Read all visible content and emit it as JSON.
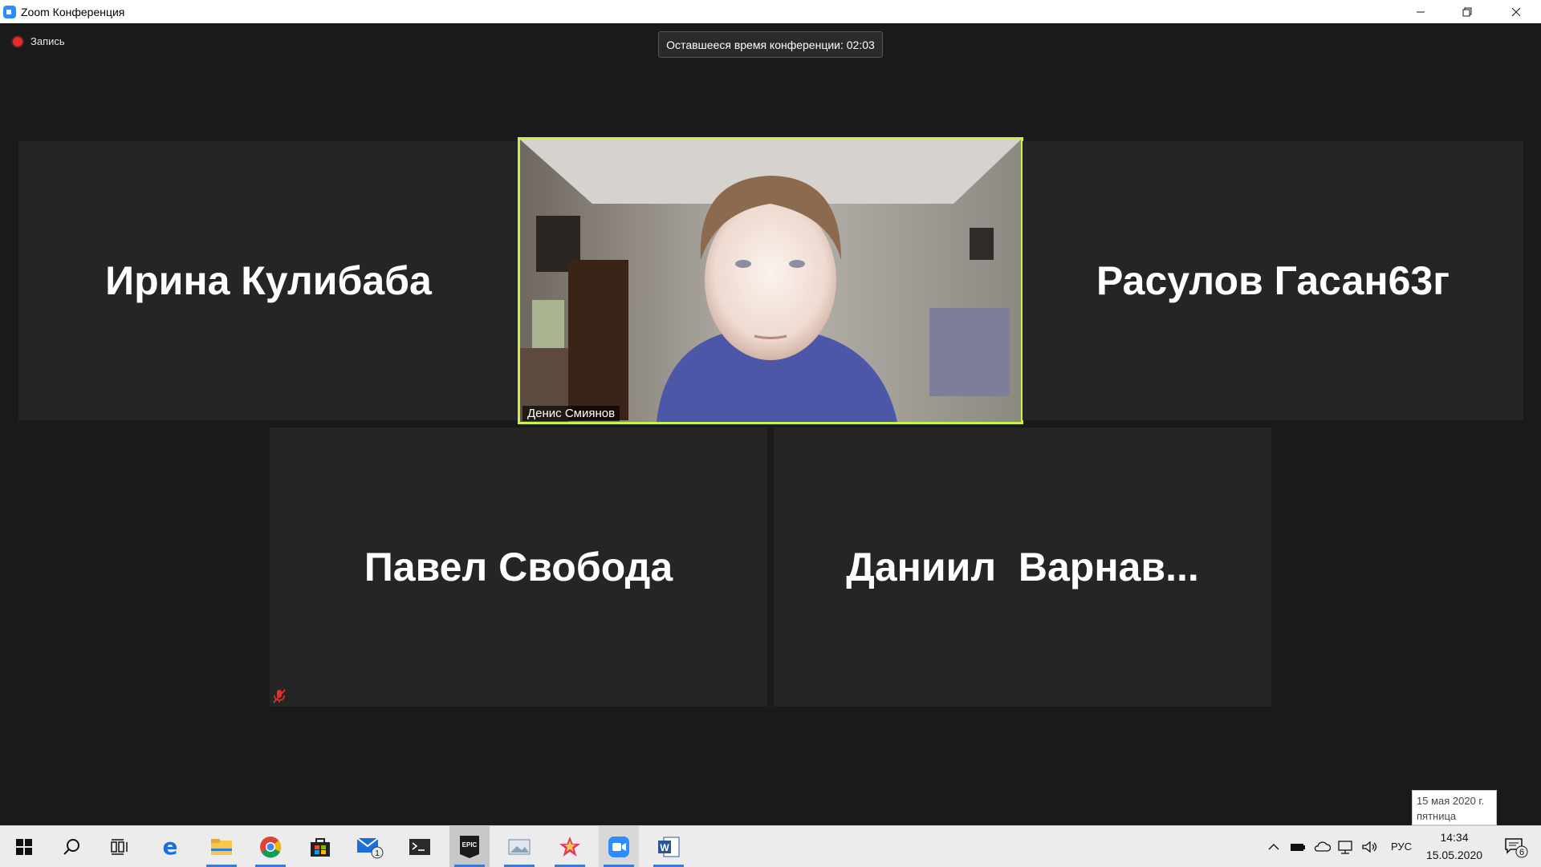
{
  "window": {
    "title": "Zoom Конференция",
    "minimize_icon": "minimize-icon",
    "restore_icon": "restore-icon",
    "close_icon": "close-icon"
  },
  "recording": {
    "label": "Запись"
  },
  "timer": {
    "text": "Оставшееся время конференции: 02:03"
  },
  "participants": [
    {
      "name": "Ирина Кулибаба",
      "video": false,
      "muted": false
    },
    {
      "name": "Денис Смиянов",
      "video": true,
      "active_speaker": true
    },
    {
      "name": "Расулов Гасан63г",
      "video": false,
      "muted": false
    },
    {
      "name": "Павел Свобода",
      "video": false,
      "muted": true
    },
    {
      "name": "Даниил  Варнав...",
      "video": false,
      "muted": false
    }
  ],
  "colors": {
    "active_speaker_border": "#c6f24a",
    "tile_bg": "#252525",
    "stage_bg": "#1a1a1a",
    "taskbar_accent": "#3a7bd5"
  },
  "taskbar": {
    "apps": [
      {
        "name": "start",
        "icon": "windows-start-icon"
      },
      {
        "name": "search",
        "icon": "search-icon"
      },
      {
        "name": "task-view",
        "icon": "task-view-icon"
      },
      {
        "name": "edge",
        "icon": "edge-icon"
      },
      {
        "name": "explorer",
        "icon": "file-explorer-icon",
        "active": true
      },
      {
        "name": "chrome",
        "icon": "chrome-icon",
        "active": true
      },
      {
        "name": "store",
        "icon": "store-icon"
      },
      {
        "name": "mail",
        "icon": "mail-icon",
        "badge": "1"
      },
      {
        "name": "terminal",
        "icon": "terminal-icon"
      },
      {
        "name": "epic",
        "icon": "epic-games-icon",
        "label": "EPIC",
        "active": true
      },
      {
        "name": "photos",
        "icon": "photos-icon",
        "active": true
      },
      {
        "name": "star",
        "icon": "star-app-icon",
        "active": true
      },
      {
        "name": "zoom",
        "icon": "zoom-icon",
        "active": true
      },
      {
        "name": "word",
        "icon": "word-icon",
        "label": "W",
        "active": true
      }
    ],
    "tray": {
      "language": "РУС",
      "time": "14:34",
      "date": "15.05.2020",
      "notifications_badge": "6"
    },
    "tooltip": {
      "line1": "15 мая 2020 г.",
      "line2": "пятница"
    }
  }
}
